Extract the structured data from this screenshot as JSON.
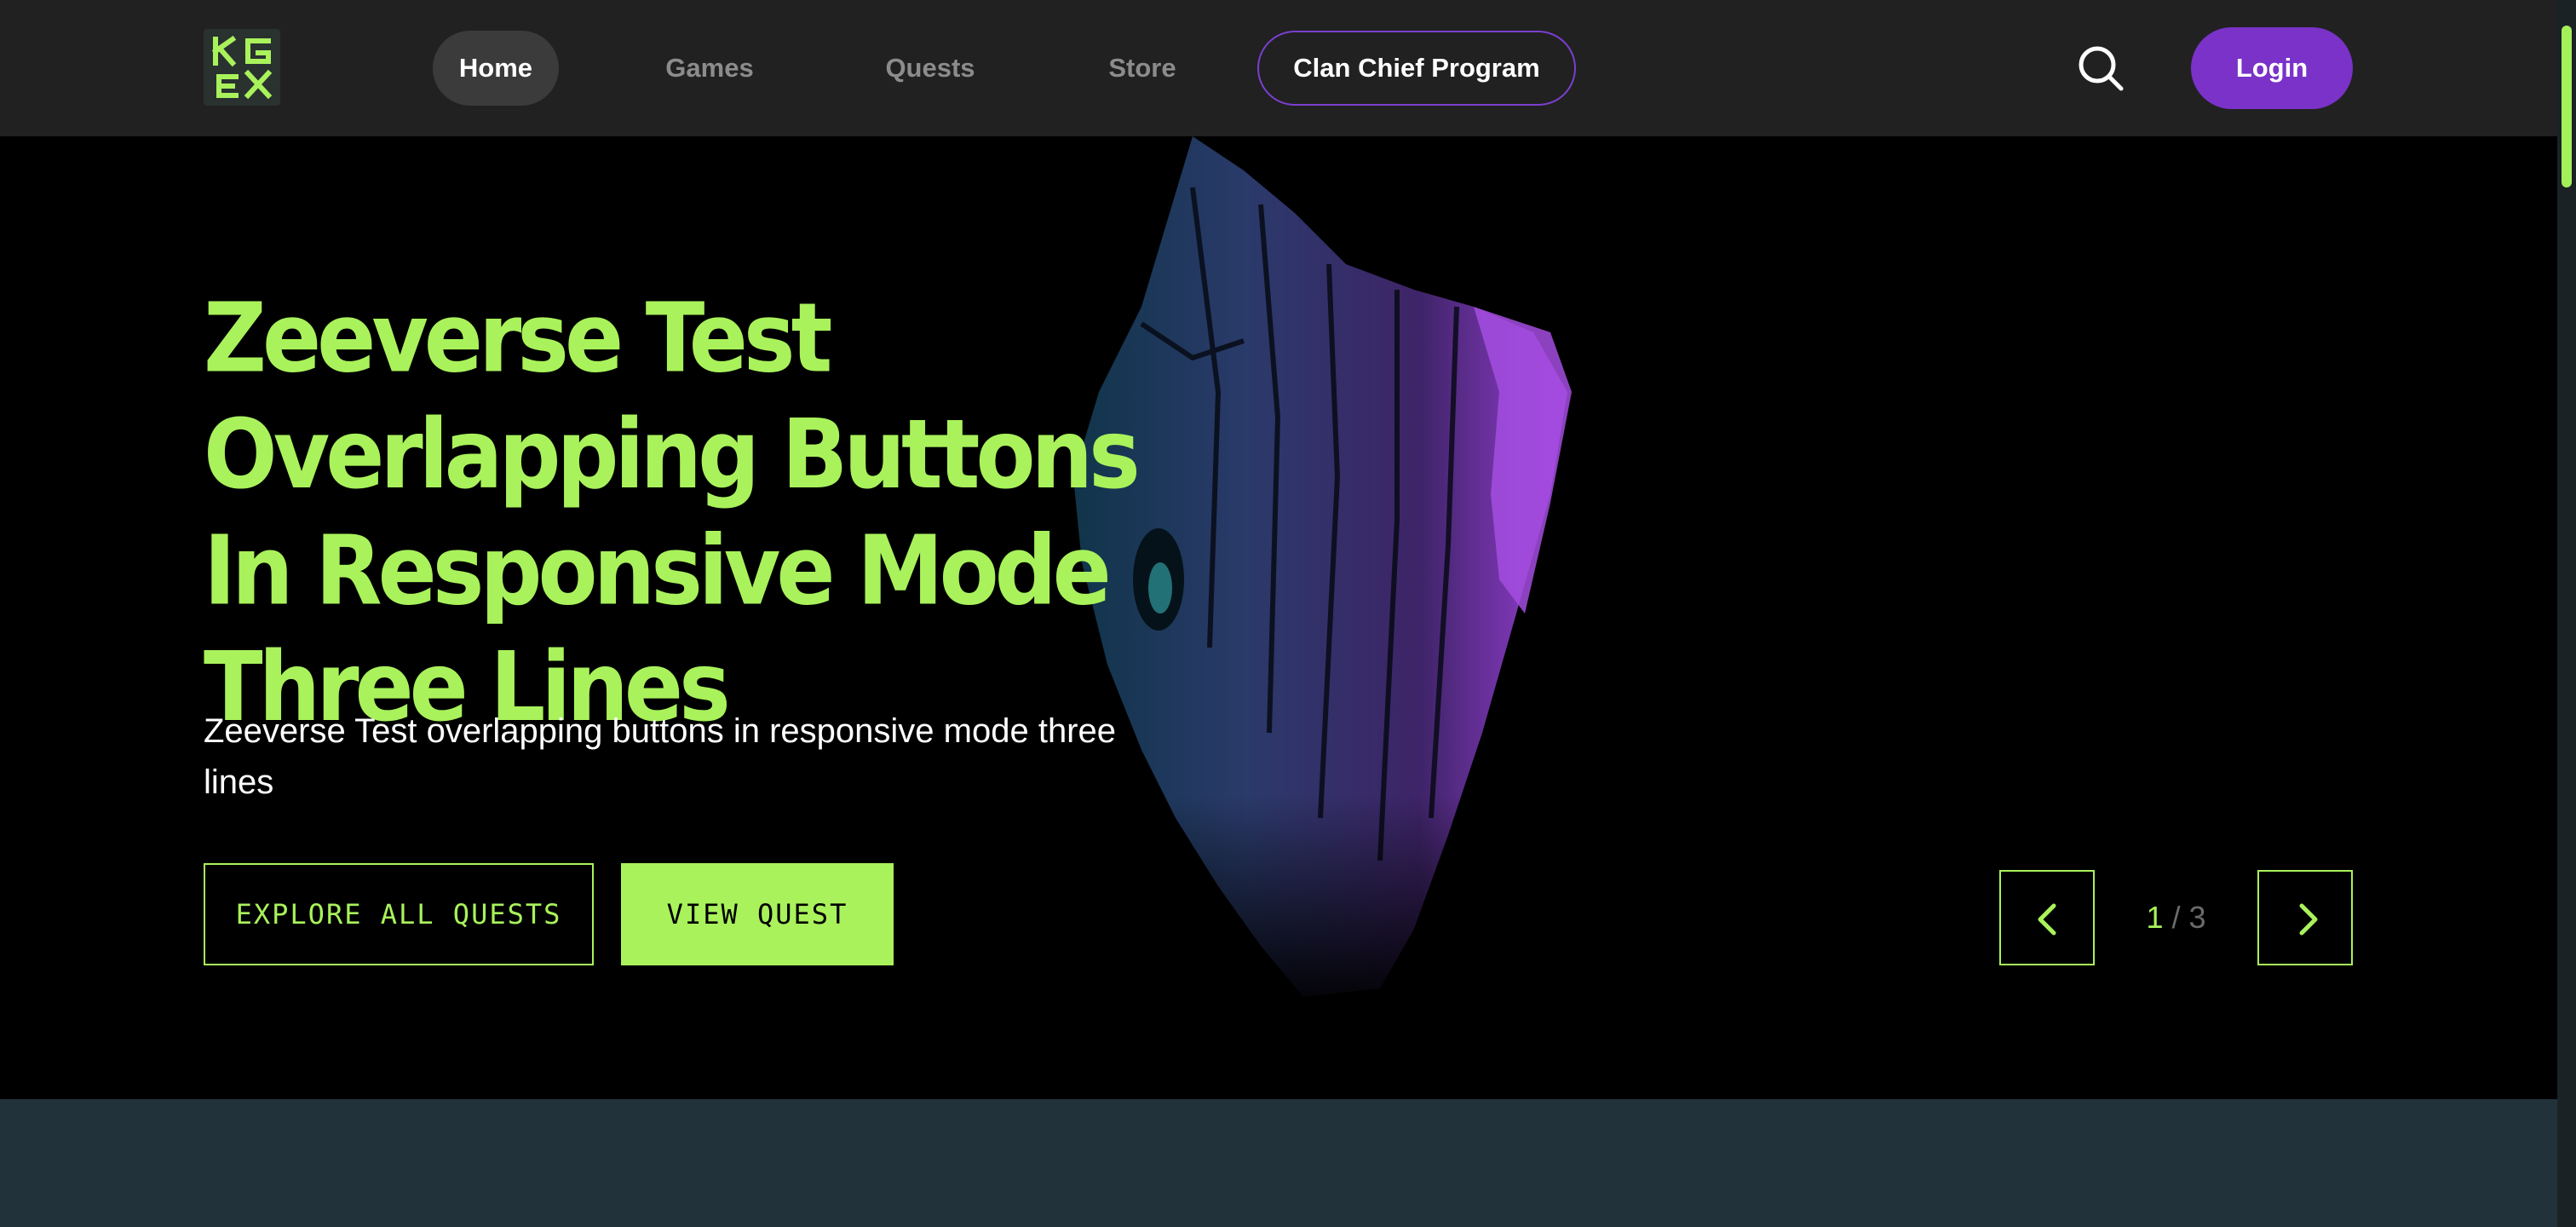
{
  "nav": {
    "logo_alt": "KGeN",
    "items": [
      {
        "label": "Home",
        "active": true
      },
      {
        "label": "Games",
        "active": false
      },
      {
        "label": "Quests",
        "active": false
      },
      {
        "label": "Store",
        "active": false
      }
    ],
    "clan_label": "Clan Chief Program",
    "search_icon": "search-icon",
    "login_label": "Login"
  },
  "hero": {
    "title": "Zeeverse Test Overlapping Buttons In Responsive Mode Three Lines",
    "subtitle": "Zeeverse Test overlapping buttons in responsive mode three lines",
    "explore_label": "EXPLORE ALL QUESTS",
    "view_label": "VIEW QUEST",
    "pager": {
      "current": "1",
      "separator": "/",
      "total": "3"
    },
    "prev_icon": "chevron-left-icon",
    "next_icon": "chevron-right-icon"
  },
  "colors": {
    "accent": "#a9f25b",
    "brand_purple": "#7a32c8",
    "nav_bg": "#212121",
    "hero_bg": "#000000",
    "below_bg": "#22323a"
  }
}
